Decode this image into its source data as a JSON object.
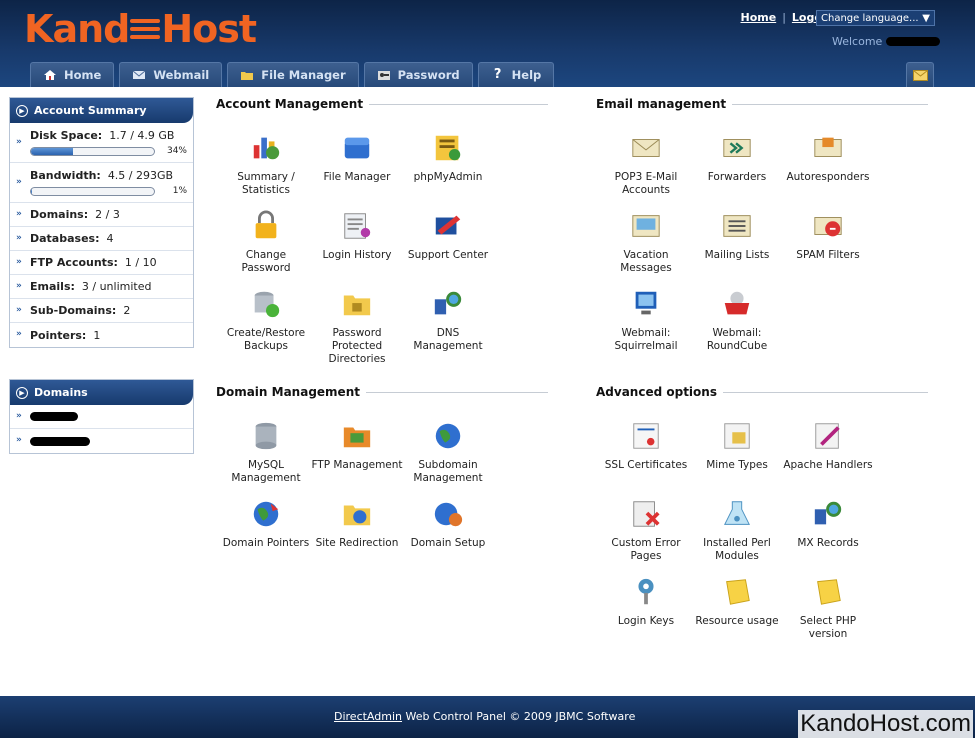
{
  "brand": {
    "name_left": "Kand",
    "name_right": "Host",
    "accent": "#f06422"
  },
  "toplinks": {
    "home": "Home",
    "separator": "|",
    "logout": "Logout",
    "language": "Change language...",
    "welcome": "Welcome"
  },
  "tabs": [
    {
      "label": "Home",
      "icon": "house-icon"
    },
    {
      "label": "Webmail",
      "icon": "envelope-icon"
    },
    {
      "label": "File Manager",
      "icon": "folder-icon"
    },
    {
      "label": "Password",
      "icon": "key-icon"
    },
    {
      "label": "Help",
      "icon": "question-icon"
    }
  ],
  "account_summary": {
    "title": "Account Summary",
    "disk": {
      "label": "Disk Space:",
      "value": "1.7 / 4.9 GB",
      "pct_label": "34%",
      "pct": 34
    },
    "bandwidth": {
      "label": "Bandwidth:",
      "value": "4.5 / 293GB",
      "pct_label": "1%",
      "pct": 1
    },
    "rows": [
      {
        "label": "Domains:",
        "value": "2 / 3"
      },
      {
        "label": "Databases:",
        "value": "4"
      },
      {
        "label": "FTP Accounts:",
        "value": "1 / 10"
      },
      {
        "label": "Emails:",
        "value": "3 / unlimited"
      },
      {
        "label": "Sub-Domains:",
        "value": "2"
      },
      {
        "label": "Pointers:",
        "value": "1"
      }
    ]
  },
  "domains_box": {
    "title": "Domains"
  },
  "sections": {
    "account": {
      "title": "Account Management",
      "items": [
        {
          "l1": "Summary /",
          "l2": "Statistics",
          "icon": "statistics-icon"
        },
        {
          "l1": "File Manager",
          "l2": "",
          "icon": "file-manager-icon"
        },
        {
          "l1": "phpMyAdmin",
          "l2": "",
          "icon": "phpmyadmin-icon"
        },
        {
          "l1": "Change",
          "l2": "Password",
          "icon": "lock-icon"
        },
        {
          "l1": "Login History",
          "l2": "",
          "icon": "login-history-icon"
        },
        {
          "l1": "Support Center",
          "l2": "",
          "icon": "support-center-icon"
        },
        {
          "l1": "Create/Restore",
          "l2": "Backups",
          "icon": "backup-icon"
        },
        {
          "l1": "Password",
          "l2": "Protected",
          "l3": "Directories",
          "icon": "protected-folder-icon"
        },
        {
          "l1": "DNS",
          "l2": "Management",
          "icon": "dns-icon"
        }
      ]
    },
    "email": {
      "title": "Email management",
      "items": [
        {
          "l1": "POP3 E-Mail",
          "l2": "Accounts",
          "icon": "envelope-icon"
        },
        {
          "l1": "Forwarders",
          "l2": "",
          "icon": "forwarder-icon"
        },
        {
          "l1": "Autoresponders",
          "l2": "",
          "icon": "autoresponder-icon"
        },
        {
          "l1": "Vacation",
          "l2": "Messages",
          "icon": "vacation-icon"
        },
        {
          "l1": "Mailing Lists",
          "l2": "",
          "icon": "mailing-list-icon"
        },
        {
          "l1": "SPAM Filters",
          "l2": "",
          "icon": "spam-filter-icon"
        },
        {
          "l1": "Webmail:",
          "l2": "Squirrelmail",
          "icon": "squirrelmail-icon"
        },
        {
          "l1": "Webmail:",
          "l2": "RoundCube",
          "icon": "roundcube-icon"
        }
      ]
    },
    "domain": {
      "title": "Domain Management",
      "items": [
        {
          "l1": "MySQL",
          "l2": "Management",
          "icon": "database-icon"
        },
        {
          "l1": "FTP Management",
          "l2": "",
          "icon": "ftp-icon"
        },
        {
          "l1": "Subdomain",
          "l2": "Management",
          "icon": "globe-icon"
        },
        {
          "l1": "Domain Pointers",
          "l2": "",
          "icon": "domain-pointer-icon"
        },
        {
          "l1": "Site Redirection",
          "l2": "",
          "icon": "site-redirection-icon"
        },
        {
          "l1": "Domain Setup",
          "l2": "",
          "icon": "domain-setup-icon"
        }
      ]
    },
    "advanced": {
      "title": "Advanced options",
      "items": [
        {
          "l1": "SSL Certificates",
          "l2": "",
          "icon": "certificate-icon"
        },
        {
          "l1": "Mime Types",
          "l2": "",
          "icon": "mime-types-icon"
        },
        {
          "l1": "Apache Handlers",
          "l2": "",
          "icon": "apache-handlers-icon"
        },
        {
          "l1": "Custom Error",
          "l2": "Pages",
          "icon": "error-page-icon"
        },
        {
          "l1": "Installed Perl",
          "l2": "Modules",
          "icon": "perl-modules-icon"
        },
        {
          "l1": "MX Records",
          "l2": "",
          "icon": "mx-records-icon"
        },
        {
          "l1": "Login Keys",
          "l2": "",
          "icon": "login-keys-icon"
        },
        {
          "l1": "Resource usage",
          "l2": "",
          "icon": "resource-usage-icon"
        },
        {
          "l1": "Select PHP",
          "l2": "version",
          "icon": "php-version-icon"
        }
      ]
    }
  },
  "footer": {
    "link": "DirectAdmin",
    "text": " Web Control Panel © 2009 JBMC Software"
  },
  "watermark": "KandoHost.com"
}
